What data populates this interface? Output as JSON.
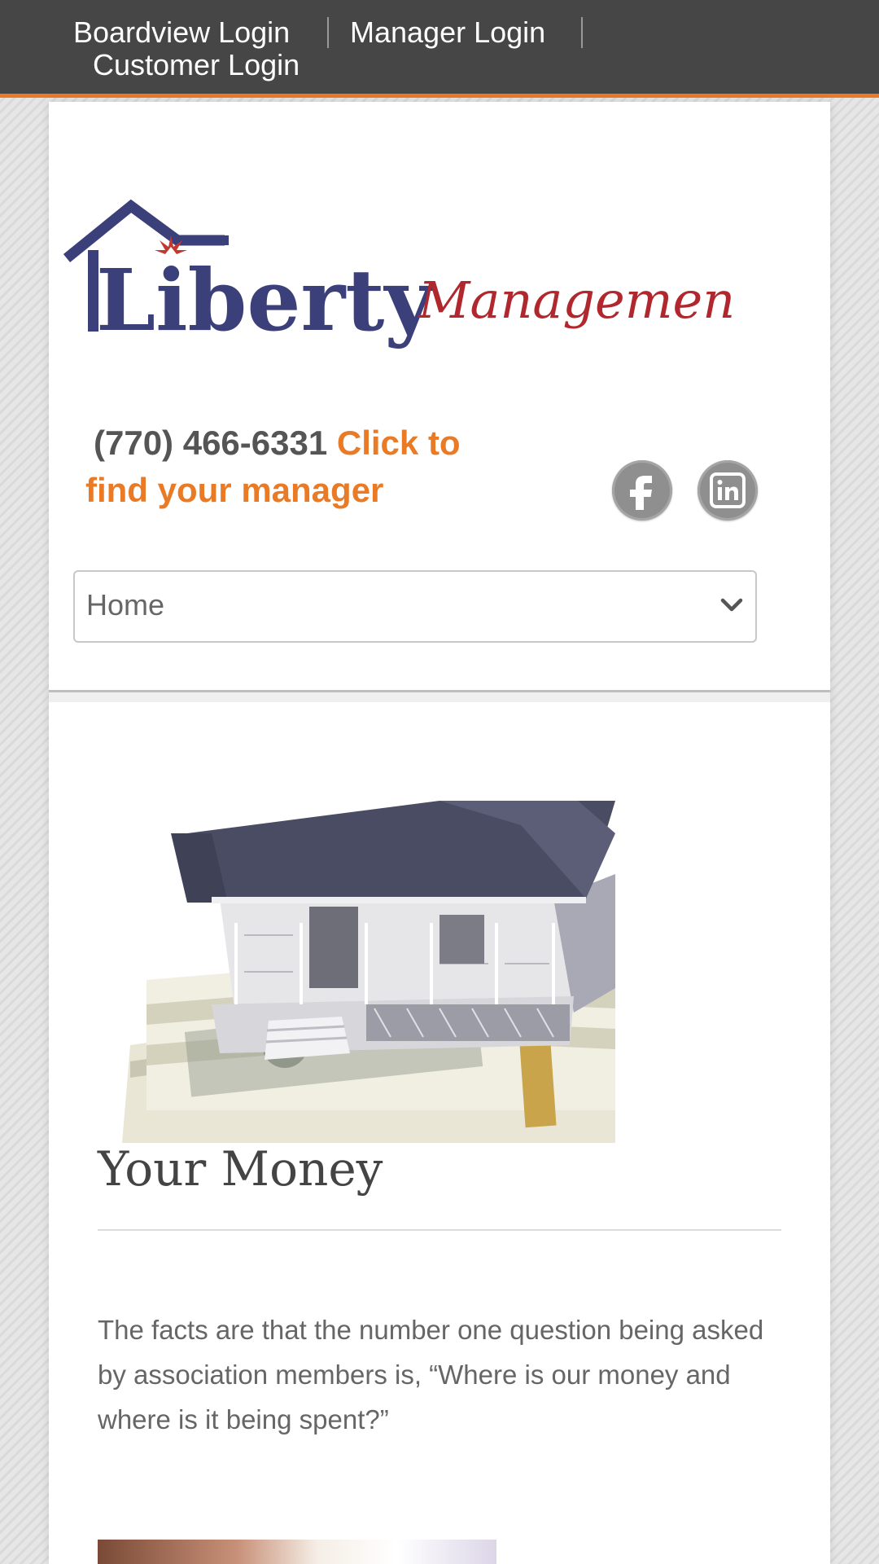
{
  "topbar": {
    "links": [
      {
        "label": "Boardview Login"
      },
      {
        "label": "Manager Login"
      },
      {
        "label": "Customer Login"
      }
    ],
    "accent_color": "#e97a26",
    "background_color": "#474646"
  },
  "header": {
    "logo": {
      "wordmark": "Liberty",
      "tagline": "Management",
      "primary_color": "#3b3f7a",
      "script_color": "#b0282e"
    },
    "phone": "(770) 466-6331",
    "cta_text": "Click to find your manager",
    "social": [
      {
        "name": "facebook",
        "glyph": "f"
      },
      {
        "name": "linkedin",
        "glyph": "in"
      }
    ],
    "menu": {
      "selected": "Home"
    }
  },
  "content": {
    "title": "Your Money",
    "paragraph": "The facts are that the number one question being asked by association members is, “Where is our money and where is it being spent?”",
    "hero_image": "house model on stacks of dollar bills"
  }
}
